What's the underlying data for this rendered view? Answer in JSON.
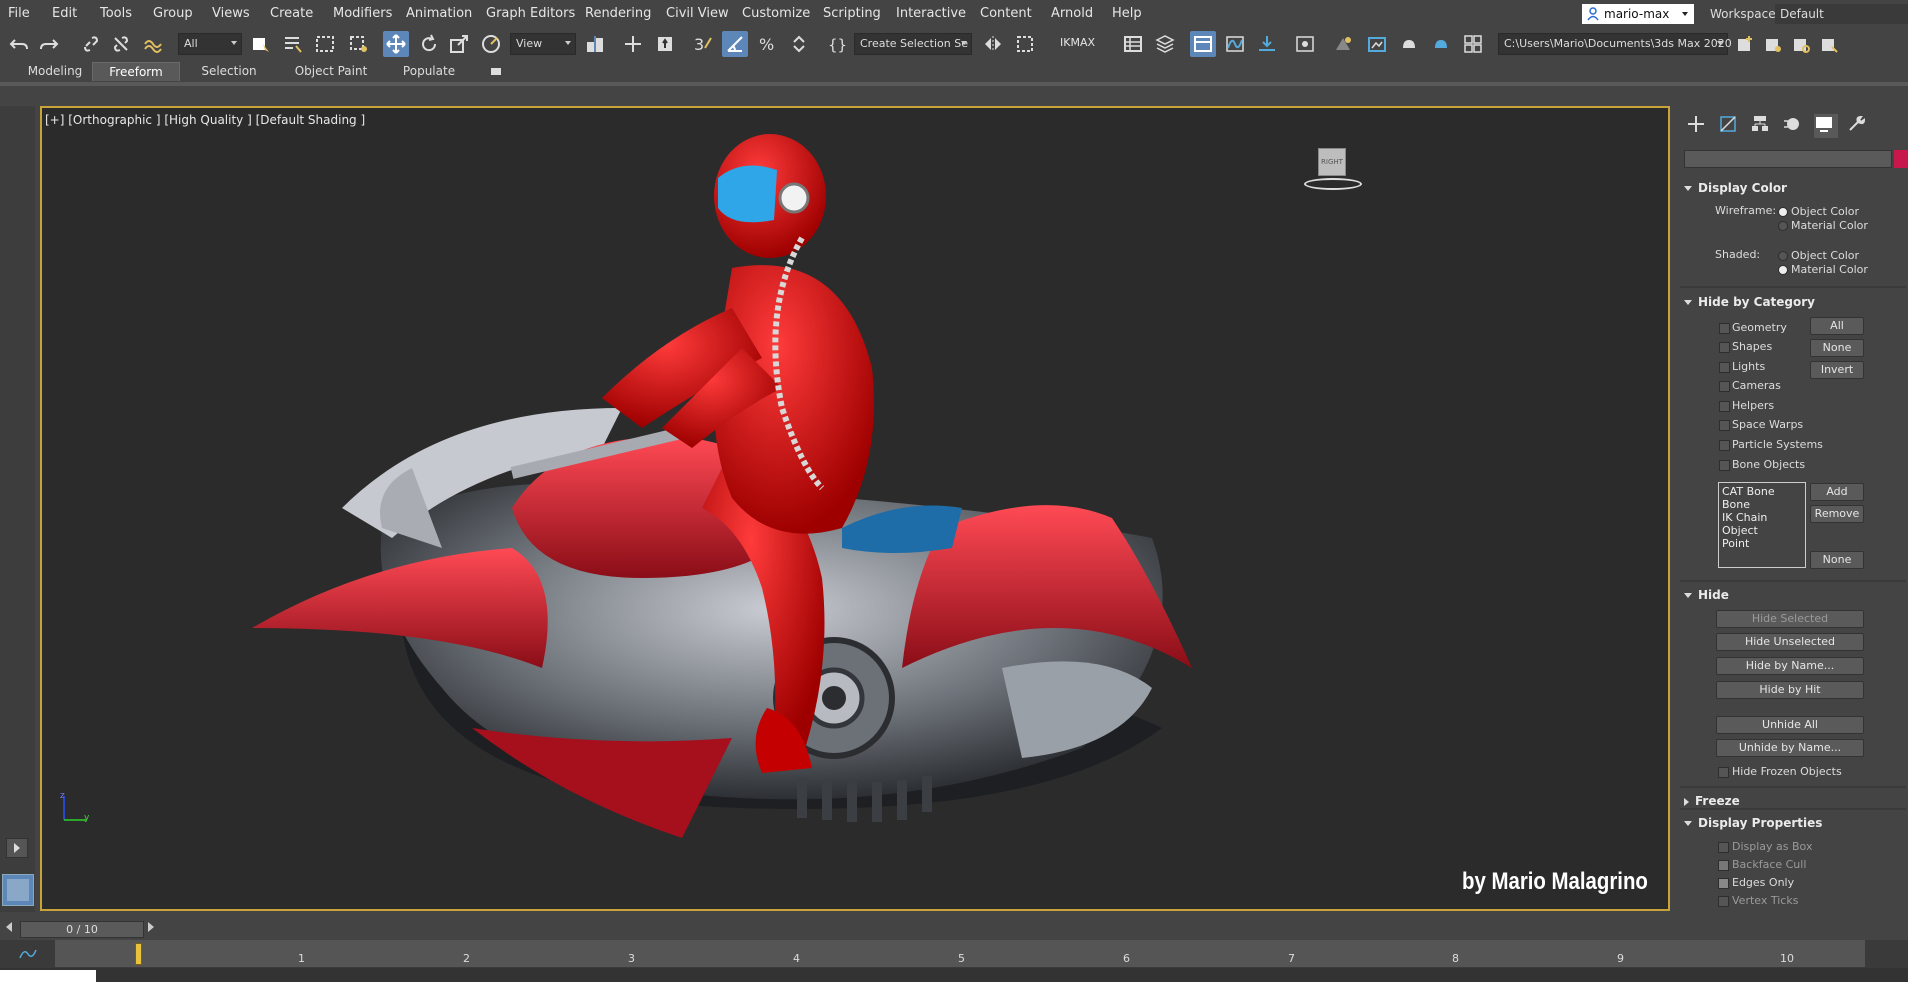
{
  "menu": [
    "File",
    "Edit",
    "Tools",
    "Group",
    "Views",
    "Create",
    "Modifiers",
    "Animation",
    "Graph Editors",
    "Rendering",
    "Civil View",
    "Customize",
    "Scripting",
    "Interactive",
    "Content",
    "Arnold",
    "Help"
  ],
  "user": "mario-max",
  "workspace_label": "Workspaces:",
  "workspace_value": "Default",
  "toolbar": {
    "filter": "All",
    "ref_coord": "View",
    "selection_set": "Create Selection Se",
    "ikmax": "IKMAX",
    "project_path": "C:\\Users\\Mario\\Documents\\3ds Max 2020"
  },
  "ribbon_tabs": [
    "Modeling",
    "Freeform",
    "Selection",
    "Object Paint",
    "Populate"
  ],
  "viewport": {
    "label": "[+] [Orthographic ] [High Quality ] [Default Shading ]",
    "viewcube_face": "RIGHT",
    "credit": "by Mario Malagrino",
    "axis_z": "z",
    "axis_y": "y"
  },
  "display_color": {
    "title": "Display Color",
    "wireframe_label": "Wireframe:",
    "shaded_label": "Shaded:",
    "object_color": "Object Color",
    "material_color": "Material Color"
  },
  "hide_by_category": {
    "title": "Hide by Category",
    "categories": [
      "Geometry",
      "Shapes",
      "Lights",
      "Cameras",
      "Helpers",
      "Space Warps",
      "Particle Systems",
      "Bone Objects"
    ],
    "btn_all": "All",
    "btn_none": "None",
    "btn_invert": "Invert",
    "list": [
      "CAT Bone",
      "Bone",
      "IK Chain Object",
      "Point"
    ],
    "btn_add": "Add",
    "btn_remove": "Remove",
    "btn_none2": "None"
  },
  "hide": {
    "title": "Hide",
    "hide_selected": "Hide Selected",
    "hide_unselected": "Hide Unselected",
    "hide_by_name": "Hide by Name...",
    "hide_by_hit": "Hide by Hit",
    "unhide_all": "Unhide All",
    "unhide_by_name": "Unhide by Name...",
    "hide_frozen": "Hide Frozen Objects"
  },
  "freeze": {
    "title": "Freeze"
  },
  "display_properties": {
    "title": "Display Properties",
    "items": [
      "Display as Box",
      "Backface Cull",
      "Edges Only",
      "Vertex Ticks"
    ]
  },
  "timeline": {
    "frame_display": "0 / 10",
    "ticks": [
      "1",
      "2",
      "3",
      "4",
      "5",
      "6",
      "7",
      "8",
      "9",
      "10"
    ]
  },
  "colors": {
    "accent": "#5d87b8",
    "viewport_border": "#c8a33a",
    "swatch": "#c8174a"
  }
}
